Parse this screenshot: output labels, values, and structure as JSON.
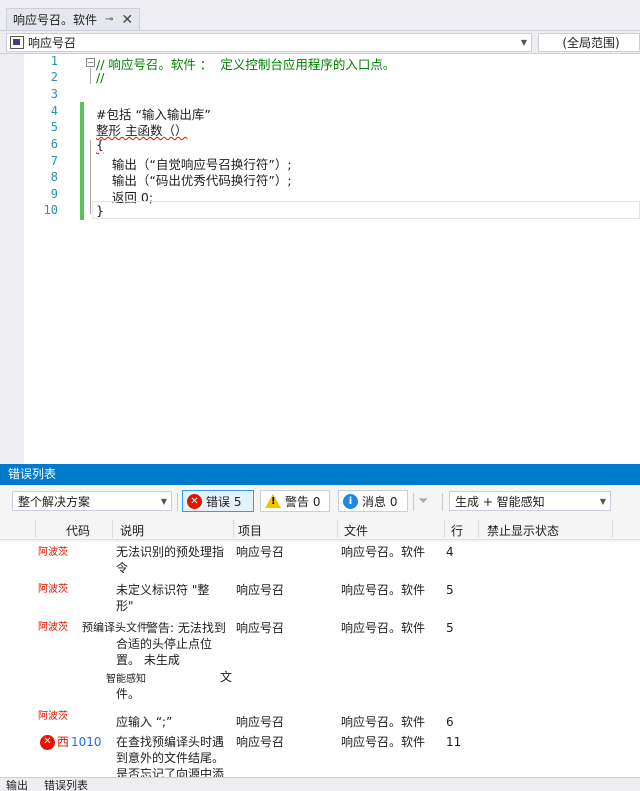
{
  "document_tab": {
    "title": "响应号召。软件",
    "pin": "⊸",
    "close": "✕"
  },
  "navbar": {
    "project": "响应号召",
    "scope": "(全局范围)"
  },
  "editor": {
    "line_numbers": [
      "1",
      "2",
      "3",
      "4",
      "5",
      "6",
      "7",
      "8",
      "9",
      "10"
    ],
    "lines": [
      "// 响应号召。软件 ：  定义控制台应用程序的入口点。",
      "//",
      "",
      "#包括 “输入输出库”",
      "整形 主函数（）",
      "{",
      "    输出（“自觉响应号召换行符”）;",
      "    输出（“码出优秀代码换行符”）;",
      "    返回 0;",
      "}"
    ]
  },
  "error_list": {
    "title": "错误列表",
    "scope_select": "整个解决方案",
    "errors_button": "错误 5",
    "warnings_button": "警告 0",
    "messages_button": "消息 0",
    "build_select": "生成 + 智能感知",
    "columns": [
      "代码",
      "说明",
      "项目",
      "文件",
      "行",
      "禁止显示状态"
    ],
    "rows": [
      {
        "tag": "阿波茨",
        "desc1": "无法识别的预处理指",
        "desc2": "令",
        "project": "响应号召",
        "file": "响应号召。软件",
        "line": "4"
      },
      {
        "tag": "阿波茨",
        "desc1": "未定义标识符 \"整",
        "desc2": "形\"",
        "project": "响应号召",
        "file": "响应号召。软件",
        "line": "5"
      },
      {
        "tag": "阿波茨",
        "prefix": "预编译头文件",
        "desc1": "警告: 无法找到",
        "desc2": "合适的头停止点位",
        "desc3": "置。 未生成",
        "desc4": "智能感知",
        "desc4b": "文",
        "desc5": "件。",
        "project": "响应号召",
        "file": "响应号召。软件",
        "line": "5"
      },
      {
        "tag": "阿波茨",
        "desc1": "应输入 “;”",
        "project": "响应号召",
        "file": "响应号召。软件",
        "line": "6"
      },
      {
        "tag": "西",
        "code": "1010",
        "desc1": "在查找预编译头时遇",
        "desc2": "到意外的文件结尾。",
        "desc3": "是否忘记了向源中添",
        "project": "响应号召",
        "file": "响应号召。软件",
        "line": "11"
      }
    ]
  },
  "bottom_tabs": [
    "输出",
    "错误列表"
  ]
}
